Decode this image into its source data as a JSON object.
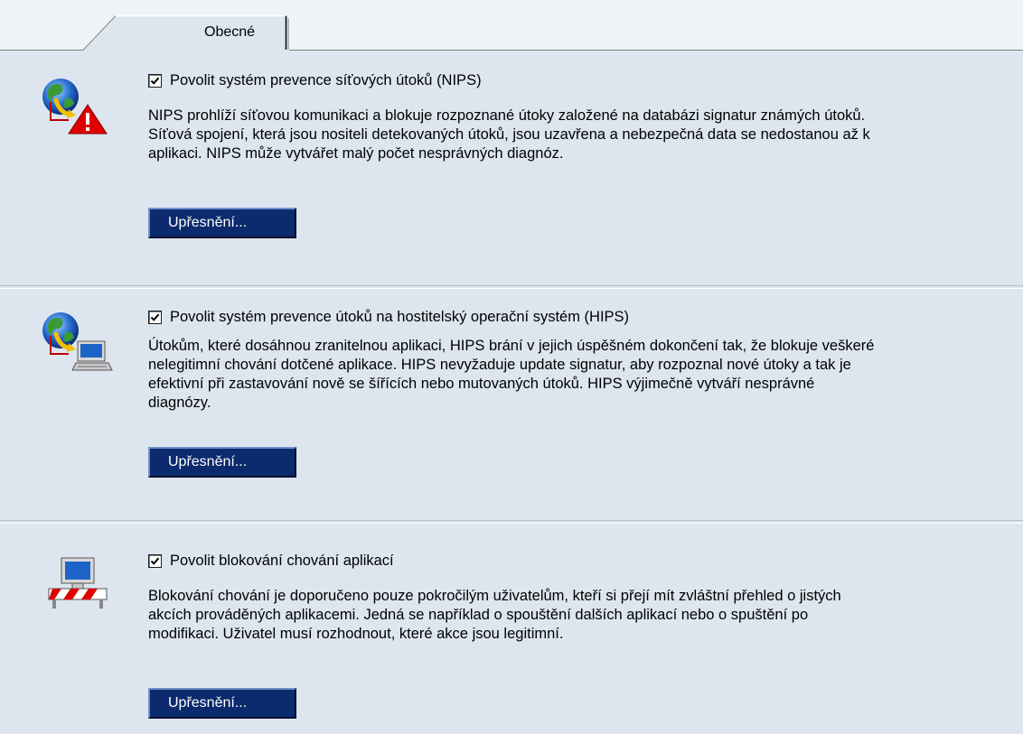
{
  "tabs": [
    {
      "label": "Obecné",
      "selected": true
    }
  ],
  "sections": [
    {
      "id": "nips",
      "checkbox_label": "Povolit systém prevence síťových útoků (NIPS)",
      "checked": true,
      "description": "NIPS prohlíží síťovou komunikaci a blokuje rozpoznané útoky založené na databázi signatur známých útoků.\nSíťová spojení, která jsou nositeli detekovaných útoků, jsou uzavřena a nebezpečná data se nedostanou až k\naplikaci. NIPS může vytvářet malý počet nesprávných diagnóz.",
      "button_label": "Upřesnění...",
      "icon": "globe-warning-icon"
    },
    {
      "id": "hips",
      "checkbox_label": "Povolit systém prevence útoků na hostitelský operační systém (HIPS)",
      "checked": true,
      "description": "Útokům, které dosáhnou zranitelnou aplikaci, HIPS brání v jejich úspěšném dokončení tak, že blokuje veškeré\nnelegitimní chování dotčené aplikace. HIPS nevyžaduje update signatur, aby rozpoznal nové útoky a tak je\nefektivní při zastavování nově se šířících nebo mutovaných útoků. HIPS výjimečně vytváří nesprávné\ndiagnózy.",
      "button_label": "Upřesnění...",
      "icon": "globe-computer-icon"
    },
    {
      "id": "behavior",
      "checkbox_label": "Povolit blokování chování aplikací",
      "checked": true,
      "description": "Blokování chování je doporučeno pouze pokročilým uživatelům, kteří si přejí mít zvláštní přehled o jistých\nakcích prováděných aplikacemi. Jedná se například o spouštění dalších aplikací nebo o spuštění po\nmodifikaci. Uživatel musí rozhodnout, které akce jsou legitimní.",
      "button_label": "Upřesnění...",
      "icon": "computer-barrier-icon"
    }
  ],
  "colors": {
    "panel_background": "#dde6ef",
    "button_background": "#0b2b6e",
    "button_text": "#ffffff"
  }
}
